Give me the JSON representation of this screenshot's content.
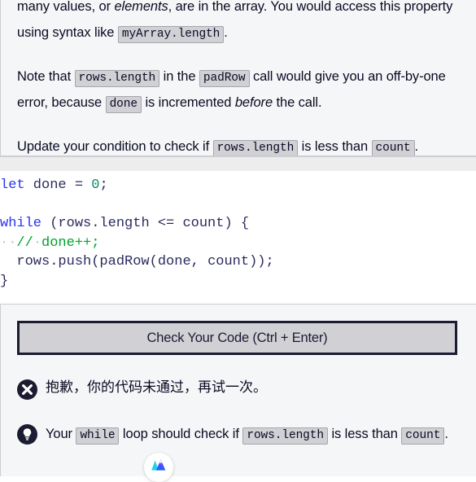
{
  "instructions": {
    "paragraphs": [
      {
        "id": "p1",
        "parts": [
          {
            "t": "text",
            "v": "many values, or "
          },
          {
            "t": "em",
            "v": "elements"
          },
          {
            "t": "text",
            "v": ", are in the array. You would access this property using syntax like "
          },
          {
            "t": "code",
            "v": "myArray.length"
          },
          {
            "t": "text",
            "v": "."
          }
        ]
      },
      {
        "id": "p2",
        "parts": [
          {
            "t": "text",
            "v": "Note that "
          },
          {
            "t": "code",
            "v": "rows.length"
          },
          {
            "t": "text",
            "v": " in the "
          },
          {
            "t": "code",
            "v": "padRow"
          },
          {
            "t": "text",
            "v": " call would give you an off-by-one error, because "
          },
          {
            "t": "code",
            "v": "done"
          },
          {
            "t": "text",
            "v": " is incremented "
          },
          {
            "t": "em",
            "v": "before"
          },
          {
            "t": "text",
            "v": " the call."
          }
        ]
      },
      {
        "id": "p3",
        "parts": [
          {
            "t": "text",
            "v": "Update your condition to check if "
          },
          {
            "t": "code",
            "v": "rows.length"
          },
          {
            "t": "text",
            "v": " is less than "
          },
          {
            "t": "code",
            "v": "count"
          },
          {
            "t": "text",
            "v": "."
          }
        ]
      }
    ]
  },
  "editor": {
    "language": "javascript",
    "lines": [
      {
        "n": 1,
        "highlighted": false,
        "tokens": [
          {
            "c": "kw",
            "v": "let"
          },
          {
            "c": "ident",
            "v": " done "
          },
          {
            "c": "punct",
            "v": "= "
          },
          {
            "c": "num",
            "v": "0"
          },
          {
            "c": "punct",
            "v": ";"
          }
        ]
      },
      {
        "n": 2,
        "highlighted": false,
        "tokens": []
      },
      {
        "n": 3,
        "highlighted": false,
        "tokens": [
          {
            "c": "kw",
            "v": "while"
          },
          {
            "c": "punct",
            "v": " ("
          },
          {
            "c": "ident",
            "v": "rows.length "
          },
          {
            "c": "punct",
            "v": "<= "
          },
          {
            "c": "ident",
            "v": "count"
          },
          {
            "c": "punct",
            "v": ") {"
          }
        ]
      },
      {
        "n": 4,
        "highlighted": true,
        "tokens": [
          {
            "c": "ws-dot",
            "v": "··"
          },
          {
            "c": "comment",
            "v": "//"
          },
          {
            "c": "ws-dot",
            "v": "·"
          },
          {
            "c": "comment",
            "v": "done++;"
          }
        ]
      },
      {
        "n": 5,
        "highlighted": false,
        "tokens": [
          {
            "c": "ident",
            "v": "  rows.push"
          },
          {
            "c": "punct",
            "v": "("
          },
          {
            "c": "ident",
            "v": "padRow"
          },
          {
            "c": "punct",
            "v": "("
          },
          {
            "c": "ident",
            "v": "done"
          },
          {
            "c": "punct",
            "v": ", "
          },
          {
            "c": "ident",
            "v": "count"
          },
          {
            "c": "punct",
            "v": "));"
          }
        ]
      },
      {
        "n": 6,
        "highlighted": false,
        "tokens": [
          {
            "c": "punct",
            "v": "}"
          }
        ]
      }
    ]
  },
  "output": {
    "check_button_label": "Check Your Code (Ctrl + Enter)",
    "fail_message": "抱歉，你的代码未通过，再试一次。",
    "fail_icon": "x-circle-icon",
    "hint_icon": "lightbulb-icon",
    "hint_parts": [
      {
        "t": "text",
        "v": "Your "
      },
      {
        "t": "code",
        "v": "while"
      },
      {
        "t": "text",
        "v": " loop should check if "
      },
      {
        "t": "code",
        "v": "rows.length"
      },
      {
        "t": "text",
        "v": " is less than "
      },
      {
        "t": "code",
        "v": "count"
      },
      {
        "t": "text",
        "v": "."
      }
    ]
  },
  "floating_badge": {
    "icon": "mountain-logo-icon",
    "colors": {
      "cyan": "#20d3e0",
      "blue": "#2b5cff",
      "violet": "#8b3bff"
    }
  },
  "theme": {
    "panel_bg": "#f5f6f7",
    "panel_border": "#cdcdd3",
    "editor_bg": "#ffffff",
    "text": "#0a0a23",
    "accent_dark": "#1b1b32",
    "button_bg": "#d0d0d5",
    "chip_bg": "#d0d0d5",
    "chip_border": "#a6a6ad",
    "keyword": "#2b35ef",
    "number": "#0b8a6b",
    "comment": "#00a22b",
    "highlight_line": "#eceef5"
  }
}
